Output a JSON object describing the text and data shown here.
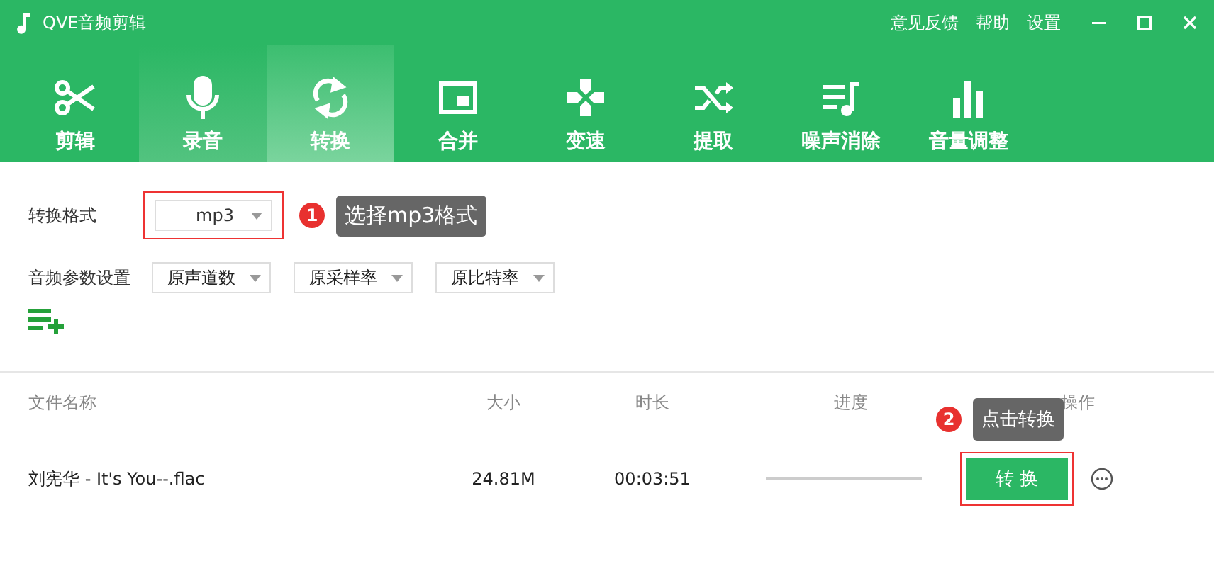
{
  "window": {
    "title": "QVE音频剪辑",
    "links": [
      "意见反馈",
      "帮助",
      "设置"
    ]
  },
  "tabs": [
    {
      "label": "剪辑",
      "kind": "scissors",
      "selected": false,
      "hovered": false
    },
    {
      "label": "录音",
      "kind": "mic",
      "selected": false,
      "hovered": true
    },
    {
      "label": "转换",
      "kind": "cycle",
      "selected": true,
      "hovered": false
    },
    {
      "label": "合并",
      "kind": "merge",
      "selected": false,
      "hovered": false
    },
    {
      "label": "变速",
      "kind": "speed",
      "selected": false,
      "hovered": false
    },
    {
      "label": "提取",
      "kind": "shuffle",
      "selected": false,
      "hovered": false
    },
    {
      "label": "噪声消除",
      "kind": "noise",
      "selected": false,
      "hovered": false
    },
    {
      "label": "音量调整",
      "kind": "bars",
      "selected": false,
      "hovered": false
    }
  ],
  "format": {
    "label": "转换格式",
    "value": "mp3",
    "hint_number": "1",
    "hint": "选择mp3格式"
  },
  "params": {
    "label": "音频参数设置",
    "selects": [
      "原声道数",
      "原采样率",
      "原比特率"
    ]
  },
  "table": {
    "columns": [
      "文件名称",
      "大小",
      "时长",
      "进度",
      "操作"
    ],
    "rows": [
      {
        "name": "刘宪华 - It's You--.flac",
        "size": "24.81M",
        "duration": "00:03:51",
        "progress": {
          "level": 0
        },
        "action": "转 换",
        "hint_number": "2",
        "hint": "点击转换"
      }
    ]
  }
}
